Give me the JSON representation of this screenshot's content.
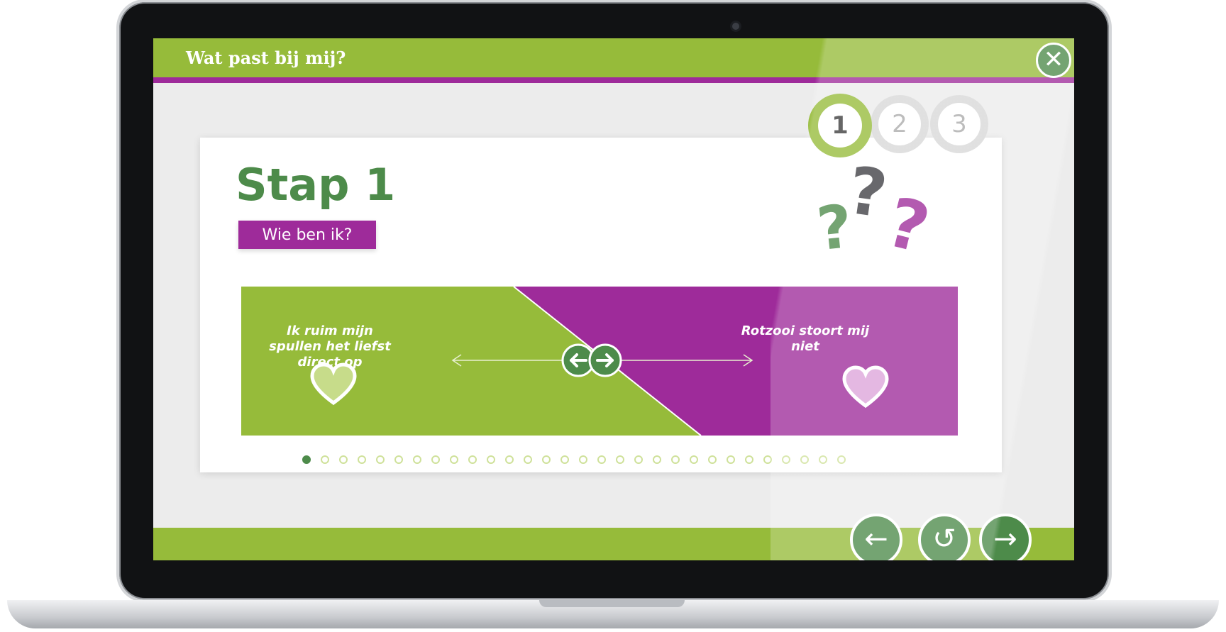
{
  "app": {
    "title": "Wat past bij mij?",
    "close_icon": "close-icon"
  },
  "steps": [
    {
      "label": "1",
      "active": true
    },
    {
      "label": "2",
      "active": false
    },
    {
      "label": "3",
      "active": false
    }
  ],
  "card": {
    "title": "Stap 1",
    "subtitle": "Wie ben ik?",
    "question_marks": [
      "?",
      "?",
      "?"
    ]
  },
  "slider": {
    "left_statement": "Ik ruim mijn spullen het liefst direct op",
    "right_statement": "Rotzooi stoort mij niet",
    "left_icon": "heart-icon",
    "right_icon": "heart-icon",
    "handle_icon": "left-right-arrows-icon"
  },
  "progress": {
    "current": 1,
    "total": 30
  },
  "navigation": {
    "back_icon": "arrow-left-icon",
    "reset_icon": "undo-icon",
    "next_icon": "arrow-right-icon"
  },
  "colors": {
    "green_light": "#96bb3a",
    "green_dark": "#4d8b4a",
    "purple": "#9e2b9a",
    "grey_q": "#3e3e42"
  }
}
